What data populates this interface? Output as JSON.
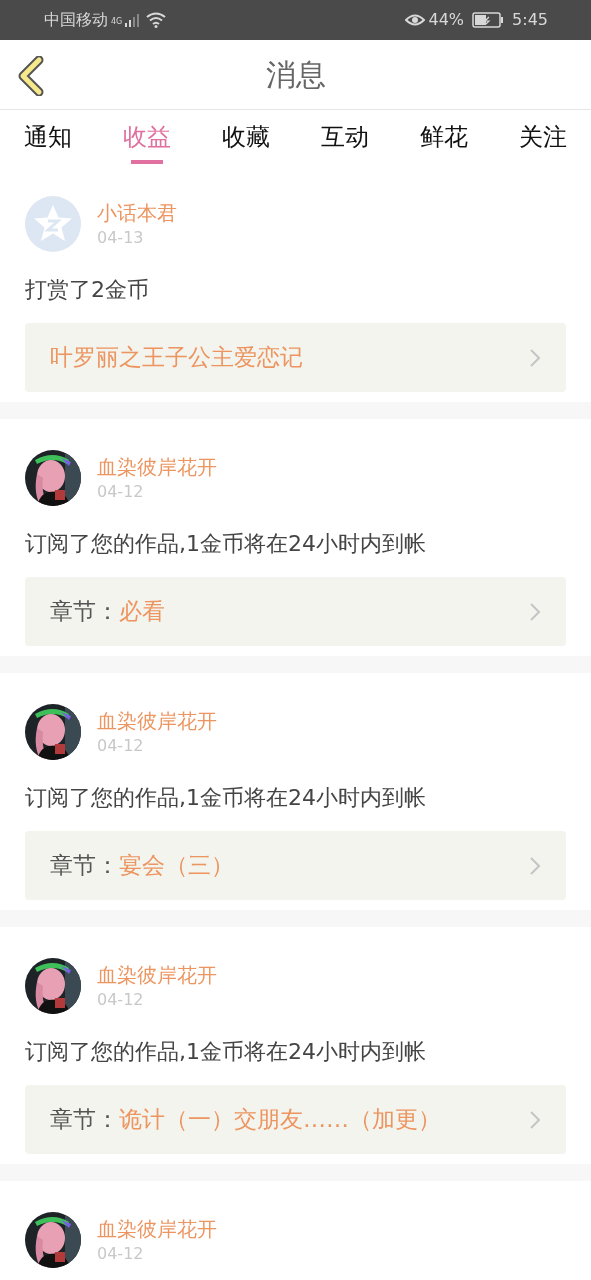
{
  "status_bar": {
    "carrier": "中国移动",
    "network": "4G",
    "battery": "44%",
    "time": "5:45"
  },
  "header": {
    "title": "消息"
  },
  "tabs": [
    {
      "label": "通知",
      "selected": false
    },
    {
      "label": "收益",
      "selected": true
    },
    {
      "label": "收藏",
      "selected": false
    },
    {
      "label": "互动",
      "selected": false
    },
    {
      "label": "鲜花",
      "selected": false
    },
    {
      "label": "关注",
      "selected": false
    }
  ],
  "messages": [
    {
      "avatar": {
        "kind": "default"
      },
      "name": "小话本君",
      "date": "04-13",
      "text": "打赏了2金币",
      "link": {
        "kind": "work",
        "title": "叶罗丽之王子公主爱恋记"
      }
    },
    {
      "name": "血染彼岸花开",
      "date": "04-12",
      "text": "订阅了您的作品,1金币将在24小时内到帐",
      "link": {
        "kind": "chapter",
        "label": "章节：",
        "title": "必看"
      }
    },
    {
      "name": "血染彼岸花开",
      "date": "04-12",
      "text": "订阅了您的作品,1金币将在24小时内到帐",
      "link": {
        "kind": "chapter",
        "label": "章节：",
        "title": "宴会（三）"
      }
    },
    {
      "name": "血染彼岸花开",
      "date": "04-12",
      "text": "订阅了您的作品,1金币将在24小时内到帐",
      "link": {
        "kind": "chapter",
        "label": "章节：",
        "title": "诡计（一）交朋友……（加更）"
      }
    },
    {
      "name": "血染彼岸花开",
      "date": "04-12"
    }
  ]
}
